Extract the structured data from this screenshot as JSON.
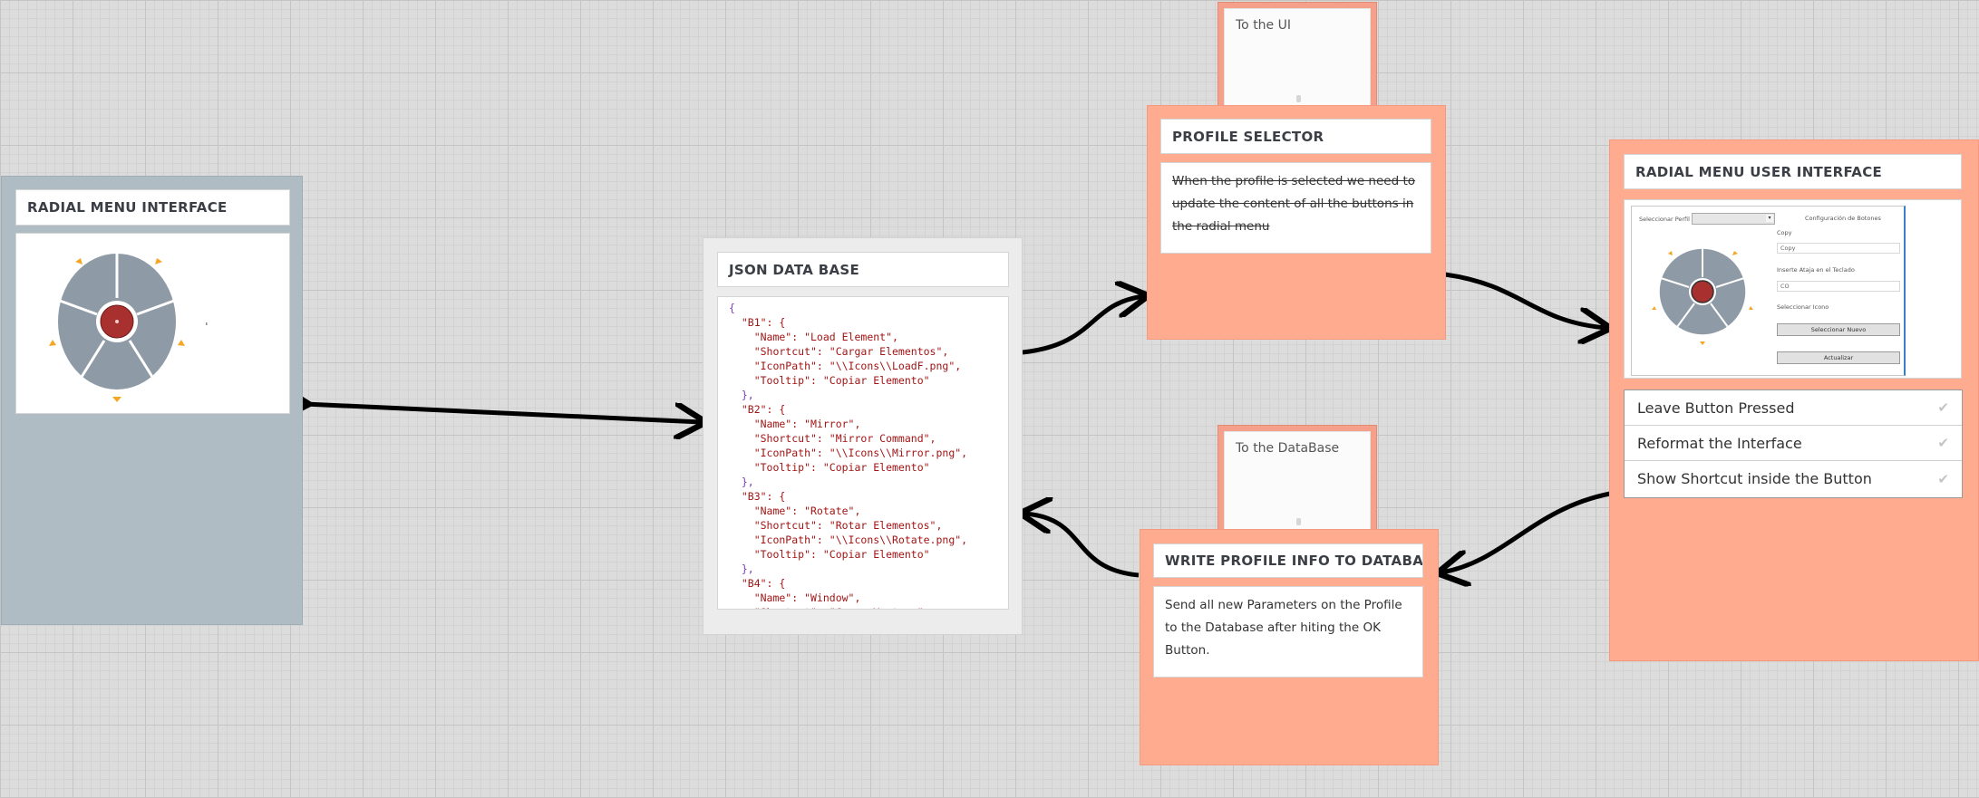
{
  "radial_menu_interface": {
    "title": "RADIAL MENU INTERFACE"
  },
  "json_database": {
    "title": "JSON DATA BASE",
    "lines": [
      "{",
      "  \"B1\": {",
      "    \"Name\": \"Load Element\",",
      "    \"Shortcut\": \"Cargar Elementos\",",
      "    \"IconPath\": \"\\\\Icons\\\\LoadF.png\",",
      "    \"Tooltip\": \"Copiar Elemento\"",
      "  },",
      "  \"B2\": {",
      "    \"Name\": \"Mirror\",",
      "    \"Shortcut\": \"Mirror Command\",",
      "    \"IconPath\": \"\\\\Icons\\\\Mirror.png\",",
      "    \"Tooltip\": \"Copiar Elemento\"",
      "  },",
      "  \"B3\": {",
      "    \"Name\": \"Rotate\",",
      "    \"Shortcut\": \"Rotar Elementos\",",
      "    \"IconPath\": \"\\\\Icons\\\\Rotate.png\",",
      "    \"Tooltip\": \"Copiar Elemento\"",
      "  },",
      "  \"B4\": {",
      "    \"Name\": \"Window\",",
      "    \"Shortcut\": \"Crear Ventana\","
    ]
  },
  "profile_selector": {
    "tab_label": "To the UI",
    "title": "PROFILE SELECTOR",
    "body": "When the profile is selected we need to update the content of all the buttons in the radial menu"
  },
  "write_profile": {
    "tab_label": "To the DataBase",
    "title": "WRITE PROFILE INFO TO DATABASE",
    "body": "Send all new Parameters on the Profile to the Database after hiting the OK Button."
  },
  "radial_menu_ui": {
    "title": "RADIAL MENU USER INTERFACE",
    "screenshot": {
      "select_label": "Seleccionar Perfil",
      "config_label": "Configuración de Botones",
      "field1_label": "Copy",
      "field1_value": "Copy",
      "field2_label": "Inserte Ataja en el Teclado",
      "field2_value": "CO",
      "icon_label": "Seleccionar Icono",
      "select_name_button": "Seleccionar Nuevo",
      "update_button": "Actualizar"
    },
    "options": [
      {
        "label": "Leave Button Pressed"
      },
      {
        "label": "Reformat the Interface"
      },
      {
        "label": "Show Shortcut inside the Button"
      }
    ]
  },
  "colors": {
    "gray_node": "#b0bcc4",
    "salmon_node": "#ffab8f",
    "wheel_segment": "#8e9aa6",
    "center_button": "#a8302f",
    "arrow_marker": "#f5a623"
  }
}
